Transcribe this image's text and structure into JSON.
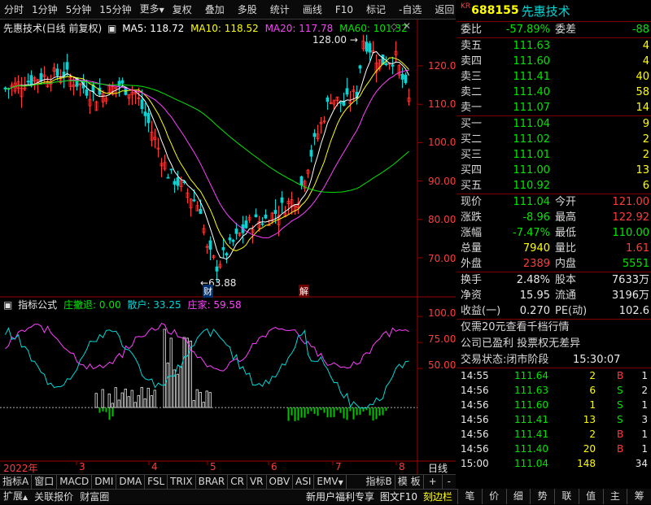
{
  "menu": {
    "left": [
      "分时",
      "1分钟",
      "5分钟",
      "15分钟",
      "更多"
    ],
    "right": [
      "复权",
      "叠加",
      "多股",
      "统计",
      "画线",
      "F10",
      "标记",
      "-自选",
      "返回"
    ]
  },
  "chart": {
    "title": "先惠技术(日线 前复权)",
    "ma": [
      {
        "label": "MA5: 118.72",
        "color": "#ffffff"
      },
      {
        "label": "MA10: 118.52",
        "color": "#ffff00"
      },
      {
        "label": "MA20: 117.78",
        "color": "#ff40ff"
      },
      {
        "label": "MA60: 101.32",
        "color": "#00e600"
      }
    ],
    "y_ticks": [
      "120.0",
      "110.0",
      "100.0",
      "90.00",
      "80.00",
      "70.00"
    ],
    "high_label": "128.00",
    "low_label": "63.88",
    "marker_cai": "财",
    "marker_jie": "解"
  },
  "indicator": {
    "title": "指标公式",
    "values": [
      {
        "label": "庄撤退: 0.00",
        "color": "#00e600"
      },
      {
        "label": "散户: 33.25",
        "color": "#00d8d8"
      },
      {
        "label": "庄家: 59.58",
        "color": "#ff40ff"
      }
    ],
    "y_ticks": [
      "100.0",
      "75.00",
      "50.00"
    ]
  },
  "xaxis": {
    "labels": [
      "2022年",
      "3",
      "4",
      "5",
      "6",
      "7",
      "8"
    ],
    "period_label": "日线"
  },
  "bottom_tabs": [
    "指标A",
    "窗口",
    "MACD",
    "DMI",
    "DMA",
    "FSL",
    "TRIX",
    "BRAR",
    "CR",
    "VR",
    "OBV",
    "ASI",
    "EMV",
    "指标B",
    "模 板",
    "+",
    "-"
  ],
  "statusbar": {
    "left": [
      "扩展",
      "关联报价",
      "财富圈"
    ],
    "mid": [
      "新用户福利专享",
      "图文F10",
      "刻边栏"
    ]
  },
  "stock": {
    "kr": "KR",
    "code": "688155",
    "name": "先惠技术"
  },
  "webi": {
    "label": "委比",
    "value": "-57.89%",
    "label2": "委差",
    "value2": "-88"
  },
  "sells": [
    {
      "label": "卖五",
      "price": "111.63",
      "vol": "4"
    },
    {
      "label": "卖四",
      "price": "111.60",
      "vol": "4"
    },
    {
      "label": "卖三",
      "price": "111.41",
      "vol": "40"
    },
    {
      "label": "卖二",
      "price": "111.40",
      "vol": "58"
    },
    {
      "label": "卖一",
      "price": "111.07",
      "vol": "14"
    }
  ],
  "buys": [
    {
      "label": "买一",
      "price": "111.04",
      "vol": "9"
    },
    {
      "label": "买二",
      "price": "111.02",
      "vol": "2"
    },
    {
      "label": "买三",
      "price": "111.01",
      "vol": "2"
    },
    {
      "label": "买四",
      "price": "111.00",
      "vol": "13"
    },
    {
      "label": "买五",
      "price": "110.92",
      "vol": "6"
    }
  ],
  "quote": [
    {
      "l1": "现价",
      "v1": "111.04",
      "c1": "#00e600",
      "l2": "今开",
      "v2": "121.00",
      "c2": "#ff3c3c"
    },
    {
      "l1": "涨跌",
      "v1": "-8.96",
      "c1": "#00e600",
      "l2": "最高",
      "v2": "122.92",
      "c2": "#ff3c3c"
    },
    {
      "l1": "涨幅",
      "v1": "-7.47%",
      "c1": "#00e600",
      "l2": "最低",
      "v2": "110.00",
      "c2": "#00e600"
    },
    {
      "l1": "总量",
      "v1": "7940",
      "c1": "#ffff00",
      "l2": "量比",
      "v2": "1.61",
      "c2": "#ff3c3c"
    },
    {
      "l1": "外盘",
      "v1": "2389",
      "c1": "#ff3c3c",
      "l2": "内盘",
      "v2": "5551",
      "c2": "#00e600"
    }
  ],
  "fundamentals": [
    {
      "l1": "换手",
      "v1": "2.48%",
      "l2": "股本",
      "v2": "7633万"
    },
    {
      "l1": "净资",
      "v1": "15.95",
      "l2": "流通",
      "v2": "3196万"
    },
    {
      "l1": "收益(一)",
      "v1": "0.270",
      "l2": "PE(动)",
      "v2": "102.6"
    }
  ],
  "promo": {
    "line1": "仅需20元查看千档行情",
    "line2": "公司已盈利 投票权无差异",
    "state_label": "交易状态:闭市阶段",
    "state_time": "15:30:07"
  },
  "trades": [
    {
      "time": "14:55",
      "price": "111.64",
      "vol": "2",
      "side": "B",
      "n": "1"
    },
    {
      "time": "14:56",
      "price": "111.63",
      "vol": "6",
      "side": "S",
      "n": "2"
    },
    {
      "time": "14:56",
      "price": "111.60",
      "vol": "1",
      "side": "S",
      "n": "1"
    },
    {
      "time": "14:56",
      "price": "111.41",
      "vol": "13",
      "side": "S",
      "n": "3"
    },
    {
      "time": "14:56",
      "price": "111.41",
      "vol": "2",
      "side": "B",
      "n": "1"
    },
    {
      "time": "14:56",
      "price": "111.40",
      "vol": "20",
      "side": "B",
      "n": "1"
    },
    {
      "time": "15:00",
      "price": "111.04",
      "vol": "148",
      "side": "",
      "n": "34"
    }
  ],
  "right_tabs": [
    "笔",
    "价",
    "细",
    "势",
    "联",
    "值",
    "主",
    "筹"
  ],
  "colors": {
    "up": "#ff3c3c",
    "down": "#00d8d8",
    "ma5": "#ffffff",
    "ma10": "#ffff00",
    "ma20": "#ff40ff",
    "ma60": "#00e600"
  }
}
